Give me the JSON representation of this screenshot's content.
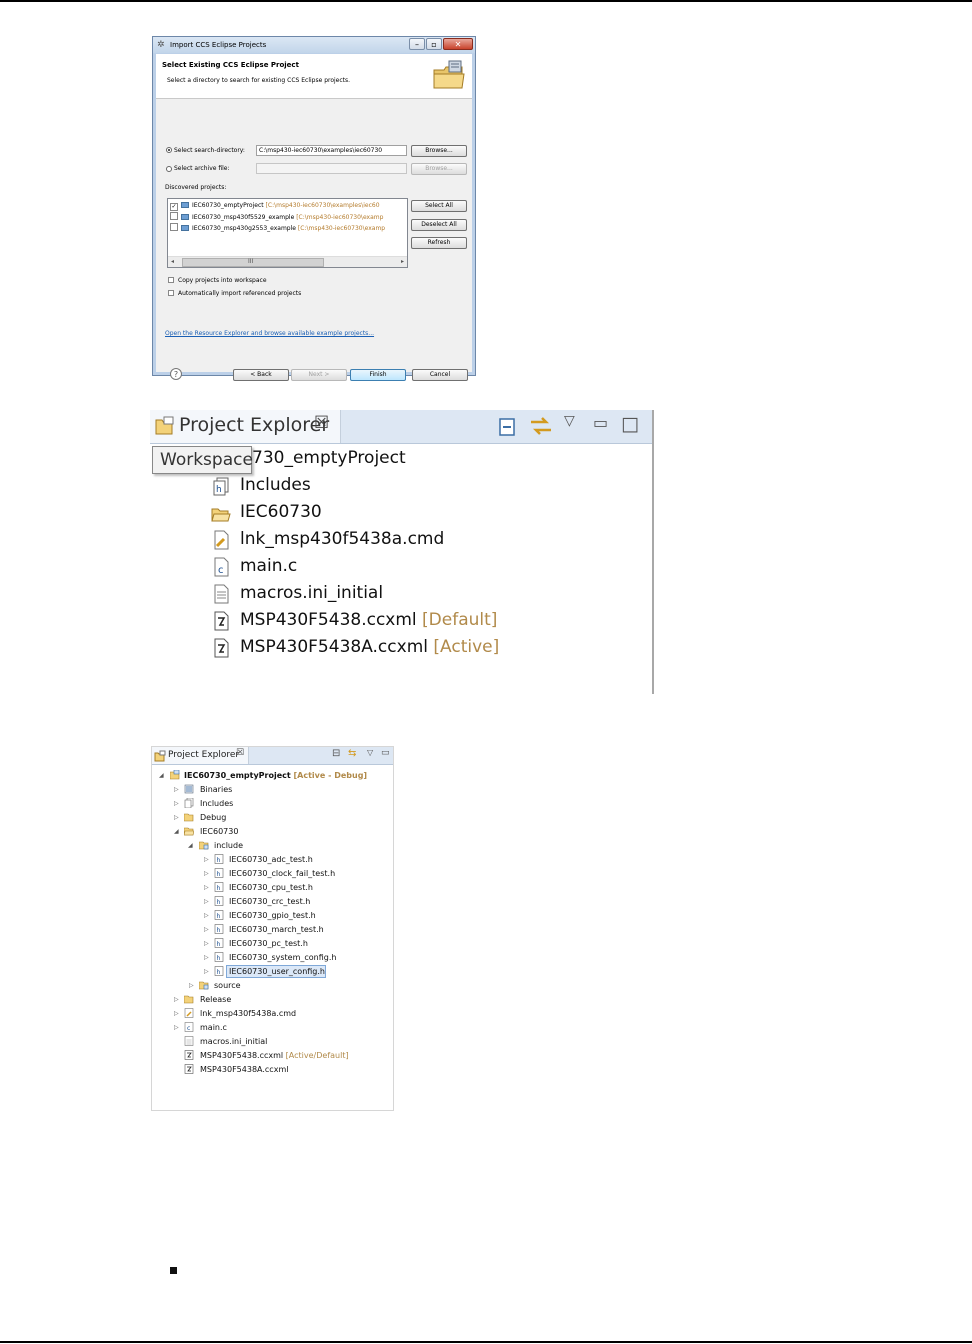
{
  "dialog": {
    "title": "Import CCS Eclipse Projects",
    "heading": "Select Existing CCS Eclipse Project",
    "subheading": "Select a directory to search for existing CCS Eclipse projects.",
    "search_dir_label": "Select search-directory:",
    "search_dir_value": "C:\\msp430-iec60730\\examples\\iec60730",
    "archive_label": "Select archive file:",
    "browse_label": "Browse...",
    "browse2_label": "Browse...",
    "discovered_label": "Discovered projects:",
    "projects": [
      {
        "name": "IEC60730_emptyProject",
        "path": "[C:\\msp430-iec60730\\examples\\iec60",
        "checked": true
      },
      {
        "name": "IEC60730_msp430f5529_example",
        "path": "[C:\\msp430-iec60730\\examp",
        "checked": false
      },
      {
        "name": "IEC60730_msp430g2553_example",
        "path": "[C:\\msp430-iec60730\\examp",
        "checked": false
      }
    ],
    "scroll_mark": "III",
    "select_all": "Select All",
    "deselect_all": "Deselect All",
    "refresh": "Refresh",
    "copy_projects": "Copy projects into workspace",
    "auto_import": "Automatically import referenced projects",
    "resource_link": "Open the Resource Explorer and browse available example projects...",
    "back": "< Back",
    "next": "Next >",
    "finish": "Finish",
    "cancel": "Cancel",
    "help": "?"
  },
  "explorer_large": {
    "tab_title": "Project Explorer",
    "tab_close": "☒",
    "tooltip": "Workspace",
    "project_suffix": "730_emptyProject",
    "items": [
      {
        "label": "Includes",
        "decoration": ""
      },
      {
        "label": "IEC60730",
        "decoration": ""
      },
      {
        "label": "lnk_msp430f5438a.cmd",
        "decoration": ""
      },
      {
        "label": "main.c",
        "decoration": ""
      },
      {
        "label": "macros.ini_initial",
        "decoration": ""
      },
      {
        "label": "MSP430F5438.ccxml",
        "decoration": "[Default]"
      },
      {
        "label": "MSP430F5438A.ccxml",
        "decoration": "[Active]"
      }
    ]
  },
  "explorer_small": {
    "tab_title": "Project Explorer",
    "tab_close": "☒",
    "project": "IEC60730_emptyProject",
    "project_decoration": "[Active - Debug]",
    "items": {
      "binaries": "Binaries",
      "includes": "Includes",
      "debug": "Debug",
      "iec60730": "IEC60730",
      "include": "include",
      "headers": [
        "IEC60730_adc_test.h",
        "IEC60730_clock_fail_test.h",
        "IEC60730_cpu_test.h",
        "IEC60730_crc_test.h",
        "IEC60730_gpio_test.h",
        "IEC60730_march_test.h",
        "IEC60730_pc_test.h",
        "IEC60730_system_config.h",
        "IEC60730_user_config.h"
      ],
      "source": "source",
      "release": "Release",
      "cmd": "lnk_msp430f5438a.cmd",
      "main": "main.c",
      "macros": "macros.ini_initial",
      "ccxml1": "MSP430F5438.ccxml",
      "ccxml1_decoration": "[Active/Default]",
      "ccxml2": "MSP430F5438A.ccxml"
    }
  }
}
